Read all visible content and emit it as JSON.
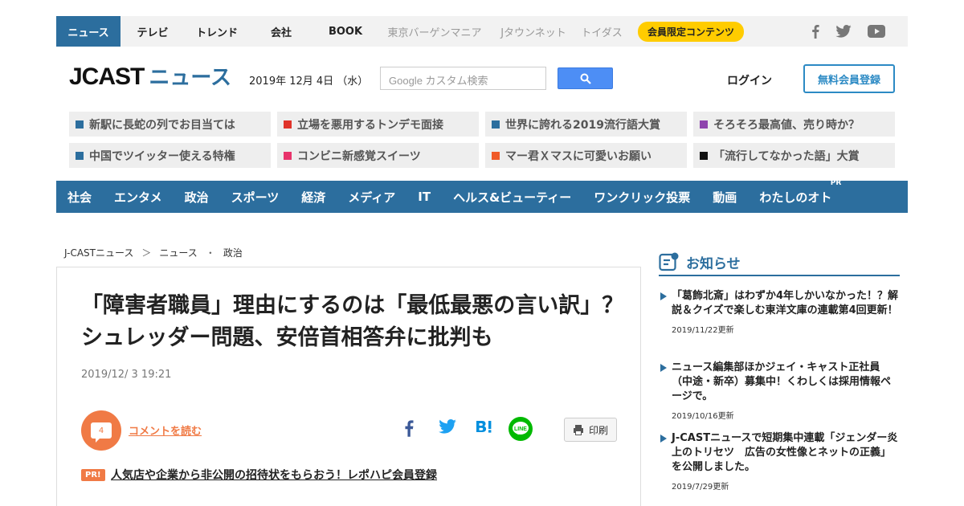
{
  "topbar": {
    "nav": [
      "ニュース",
      "テレビ",
      "トレンド",
      "会社",
      "BOOK"
    ],
    "subnav": [
      "東京バーゲンマニア",
      "Jタウンネット",
      "トイダス"
    ],
    "member_badge": "会員限定コンテンツ",
    "social_icons": [
      "facebook-icon",
      "twitter-icon",
      "youtube-icon"
    ]
  },
  "header": {
    "logo_brand": "JCAST",
    "logo_news": "ニュース",
    "date": "2019年 12月 4日 （水）",
    "search_placeholder": "Google カスタム検索",
    "login_label": "ログイン",
    "register_label": "無料会員登録"
  },
  "topics": [
    {
      "label": "新駅に長蛇の列でお目当ては",
      "color": "#2c6e9e"
    },
    {
      "label": "立場を悪用するトンデモ面接",
      "color": "#e0332a"
    },
    {
      "label": "世界に誇れる2019流行語大賞",
      "color": "#2c6e9e"
    },
    {
      "label": "そろそろ最高値、売り時か？",
      "color": "#8e44ad"
    },
    {
      "label": "中国でツイッター使える特権",
      "color": "#2c6e9e"
    },
    {
      "label": "コンビニ新感覚スイーツ",
      "color": "#e8336b"
    },
    {
      "label": "マー君Ｘマスに可愛いお願い",
      "color": "#f05a28"
    },
    {
      "label": "「流行してなかった語」大賞",
      "color": "#111111"
    }
  ],
  "categories": [
    "社会",
    "エンタメ",
    "政治",
    "スポーツ",
    "経済",
    "メディア",
    "IT",
    "ヘルス&ビューティー",
    "ワンクリック投票",
    "動画",
    "わたしのオト"
  ],
  "categories_pr": "PR",
  "breadcrumb": [
    "J-CASTニュース",
    "＞",
    "ニュース",
    "・",
    "政治"
  ],
  "article": {
    "title": "「障害者職員」理由にするのは「最低最悪の言い訳」？　シュレッダー問題、安倍首相答弁に批判も",
    "date": "2019/12/ 3 19:21",
    "comment_count": "4",
    "comment_label": "コメントを読む",
    "print_label": "印刷",
    "pr_badge": "PR!",
    "pr_link": "人気店や企業から非公開の招待状をもらおう！レポハピ会員登録"
  },
  "notices": {
    "title": "お知らせ",
    "items": [
      {
        "text": "「葛飾北斎」はわずか4年しかいなかった！？解説＆クイズで楽しむ東洋文庫の連載第4回更新！",
        "date": "2019/11/22更新"
      },
      {
        "text": "ニュース編集部ほかジェイ・キャスト正社員（中途・新卒）募集中！くわしくは採用情報ページで。",
        "date": "2019/10/16更新"
      },
      {
        "text": "J-CASTニュースで短期集中連載「ジェンダー炎上のトリセツ　広告の女性像とネットの正義」を公開しました。",
        "date": "2019/7/29更新"
      }
    ]
  }
}
